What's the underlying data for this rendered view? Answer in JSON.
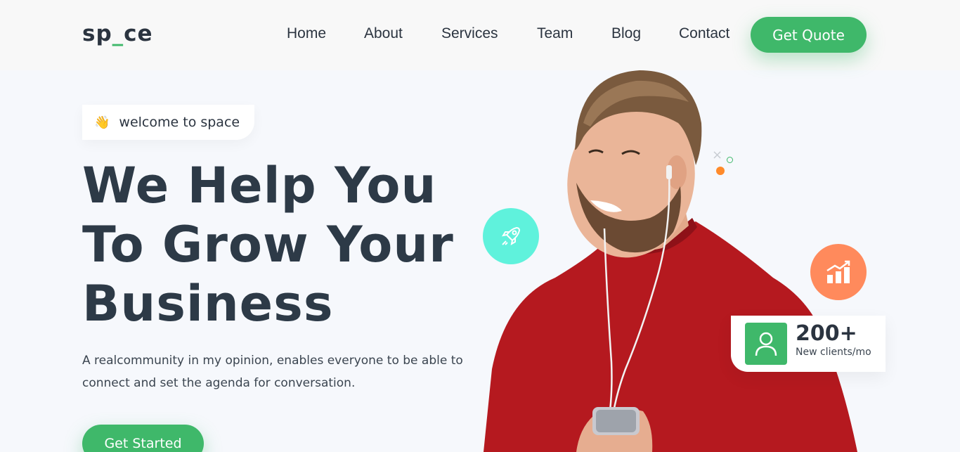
{
  "header": {
    "logo": {
      "part1": "sp",
      "part2": "_",
      "part3": "ce"
    },
    "nav": [
      "Home",
      "About",
      "Services",
      "Team",
      "Blog",
      "Contact"
    ],
    "cta": "Get Quote"
  },
  "hero": {
    "welcome_icon": "waving-hand-icon",
    "welcome": "welcome to space",
    "headline_line1": "We Help You",
    "headline_line2": "To Grow Your",
    "headline_line3": "Business",
    "description": "A realcommunity in my opinion, enables everyone to be able to connect and set the agenda for conversation.",
    "cta": "Get Started"
  },
  "stat": {
    "icon": "user-icon",
    "number": "200+",
    "label": "New clients/mo"
  },
  "colors": {
    "accent": "#3fb86a",
    "rocket_bg": "#5ff2dc",
    "growth_bg": "#ff8a5c",
    "heading": "#2d3a47"
  }
}
